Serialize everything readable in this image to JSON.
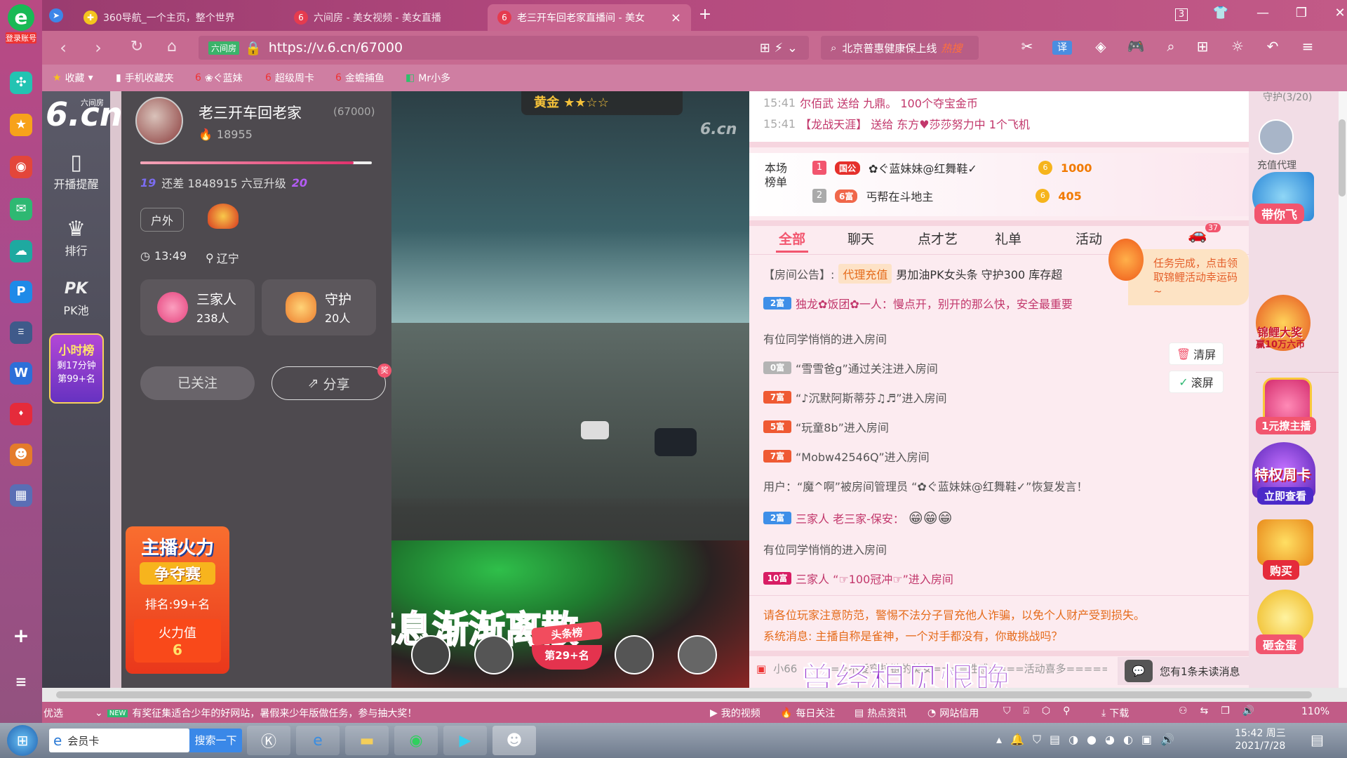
{
  "leftbar": {
    "login_label": "登录账号",
    "e_label": "e"
  },
  "tabs": [
    {
      "title": "360导航_一个主页，整个世界"
    },
    {
      "title": "六间房 - 美女视频 - 美女直播"
    },
    {
      "title": "老三开车回老家直播间 - 美女"
    }
  ],
  "tabbar": {
    "new_tab": "+",
    "badge": "3"
  },
  "navbar": {
    "url_prefix": "六间房",
    "url": "https://v.6.cn/67000",
    "search_text": "北京普惠健康保上线",
    "search_hot": "热搜",
    "zoom": "110%"
  },
  "bookmarks": [
    {
      "label": "收藏"
    },
    {
      "label": "手机收藏夹"
    },
    {
      "label": "❀ぐ蓝妹"
    },
    {
      "label": "超级周卡"
    },
    {
      "label": "金蟾捕鱼"
    },
    {
      "label": "Mr小多"
    }
  ],
  "site_side": {
    "logo": "6.cn",
    "logo_small": "六间房",
    "items": [
      {
        "label": "开播提醒"
      },
      {
        "label": "排行"
      },
      {
        "label": "PK池"
      }
    ],
    "hour_rank": {
      "title": "小时榜",
      "remain": "剩17分钟",
      "pos": "第99+名"
    }
  },
  "anchor": {
    "name": "老三开车回老家",
    "id": "(67000)",
    "fans": "18955",
    "level_from": "19",
    "level_to": "20",
    "upgrade_text": "还差 1848915 六豆升级",
    "tag": "户外",
    "time": "13:49",
    "location": "辽宁",
    "family": {
      "label": "三家人",
      "count": "238人"
    },
    "guard": {
      "label": "守护",
      "count": "20人"
    },
    "follow": "已关注",
    "share": "分享",
    "fire": {
      "title1": "主播火力",
      "title2": "争夺赛",
      "rank": "排名:99+名",
      "value_label": "火力值",
      "value": "6"
    }
  },
  "video": {
    "watermark": "6.cn",
    "top_badge": "黄金",
    "lyric": "无声无息渐渐离散",
    "toutiao": "头条榜",
    "toutiao_pos": "第29+名"
  },
  "right": {
    "gift_lines": [
      {
        "time": "15:41",
        "text": "尔佰武 送给 九鼎。 100个夺宝金币"
      },
      {
        "time": "15:41",
        "text": "【龙战天涯】 送给 东方♥莎莎努力中 1个飞机"
      }
    ],
    "rank_title": "本场榜单",
    "rank": [
      {
        "no": "1",
        "badge": "国公",
        "name": "✿ぐ蓝妹妹@红舞鞋✓",
        "value": "1000"
      },
      {
        "no": "2",
        "badge": "6富",
        "name": "丐帮在斗地主",
        "value": "405"
      }
    ],
    "chat_tabs": [
      "全部",
      "聊天",
      "点才艺",
      "礼单",
      "活动"
    ],
    "car_count": "37",
    "notice_label": "【房间公告】:",
    "notice_tag": "代理充值",
    "notice_text": "男加油PK女头条 守护300 库存超",
    "task_popup": "任务完成，点击领取锦鲤活动幸运码~",
    "chat": [
      {
        "lvl": "2富",
        "text": "独龙✿饭团✿一人：慢点开，别开的那么快，安全最重要"
      },
      {
        "lvl": "",
        "text": "有位同学悄悄的进入房间"
      },
      {
        "lvl": "0富",
        "text": "“雪雪爸g”通过关注进入房间"
      },
      {
        "lvl": "7富",
        "text": "“♪沉默阿斯蒂芬♫♬”进入房间"
      },
      {
        "lvl": "5富",
        "text": "“玩童8b”进入房间"
      },
      {
        "lvl": "7富",
        "text": "“Mobw42546Q”进入房间"
      },
      {
        "lvl": "",
        "text": "用户：“魔^啊”被房间管理员 “✿ぐ蓝妹妹@红舞鞋✓”恢复发言！"
      },
      {
        "lvl": "2富",
        "text": "三家人  老三家-保安："
      },
      {
        "lvl": "",
        "text": "有位同学悄悄的进入房间"
      },
      {
        "lvl": "10富",
        "text": "三家人 “☞100冠冲☞”进入房间"
      }
    ],
    "clear_btn": "清屏",
    "scroll_btn": "滚屏",
    "warn_text": "请各位玩家注意防范，警惕不法分子冒充他人诈骗，以免个人财产受到损失。",
    "system_text": "系统消息: 主播自称是雀神，一个对手都没有，你敢挑战吗？",
    "bottom_user": "小66",
    "bottom_marquee": "=====不爱穿拉链的美女====性感====活动喜多======",
    "bottom_lyric": "曾经相见恨晚",
    "unread": "您有1条未读消息"
  },
  "farright": {
    "guard_title": "守护(3/20)",
    "labels": [
      "充值代理",
      "带你飞",
      "锦鲤大奖",
      "赢10万六币",
      "1元撩主播",
      "特权周卡",
      "立即查看",
      "购买",
      "砸金蛋"
    ]
  },
  "statusbar": {
    "today": "今日优选",
    "news": "有奖征集适合少年的好网站，暑假来少年版做任务，参与抽大奖！",
    "items": [
      "我的视频",
      "每日关注",
      "热点资讯",
      "网站信用",
      "下载"
    ],
    "zoom": "110%"
  },
  "taskbar": {
    "app_label": "会员卡",
    "search_btn": "搜索一下",
    "time": "15:42 周三",
    "date": "2021/7/28"
  }
}
